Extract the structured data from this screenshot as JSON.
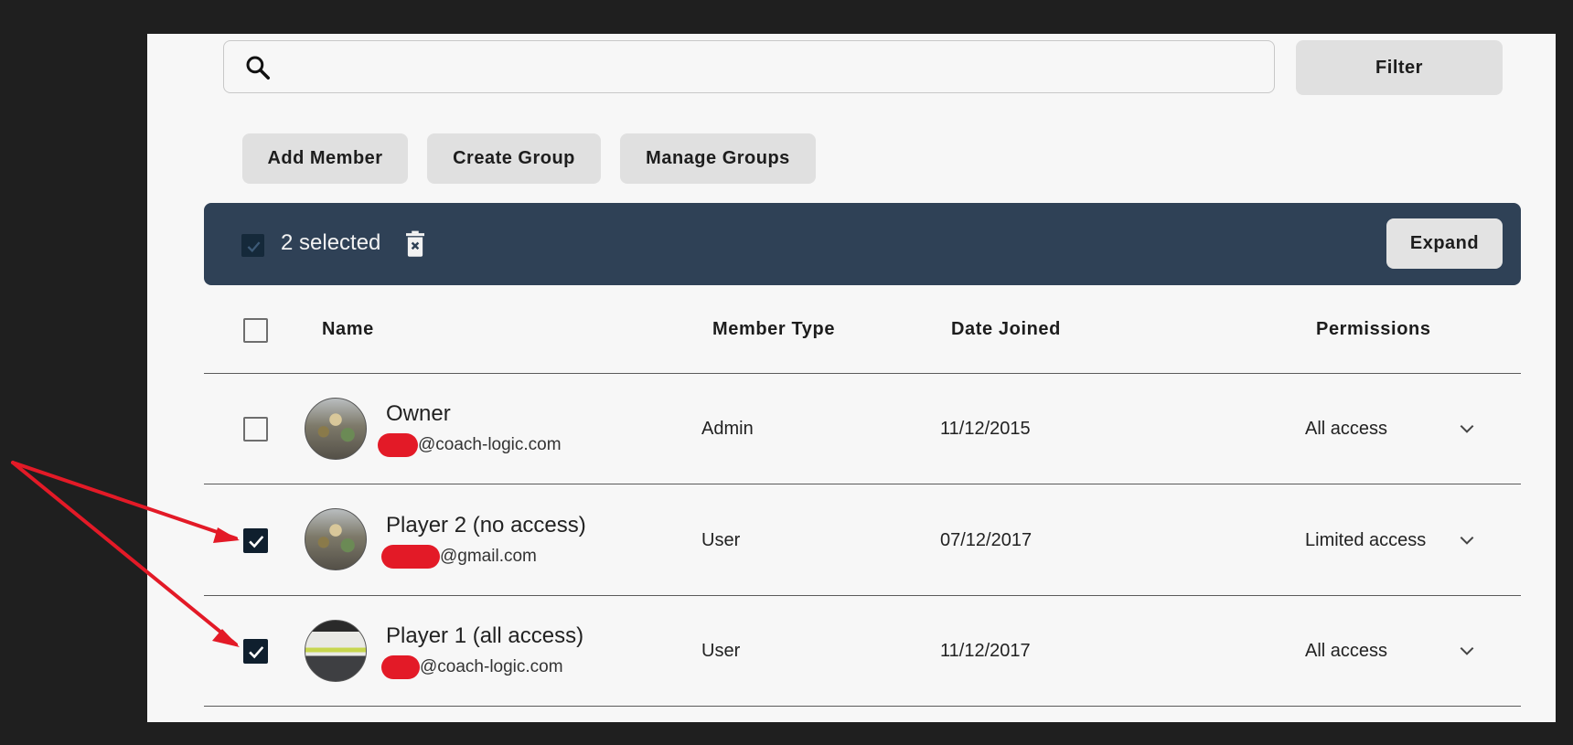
{
  "search": {
    "placeholder": "",
    "value": ""
  },
  "toolbar": {
    "filter_label": "Filter",
    "add_member_label": "Add Member",
    "create_group_label": "Create Group",
    "manage_groups_label": "Manage Groups"
  },
  "selection_bar": {
    "selected_text": "2 selected",
    "expand_label": "Expand",
    "checked": true
  },
  "table": {
    "headers": {
      "name": "Name",
      "member_type": "Member Type",
      "date_joined": "Date Joined",
      "permissions": "Permissions"
    },
    "rows": [
      {
        "checked": false,
        "name": "Owner",
        "email_domain": "@coach-logic.com",
        "member_type": "Admin",
        "date_joined": "11/12/2015",
        "permissions": "All access",
        "avatar": "photo-a"
      },
      {
        "checked": true,
        "name": "Player 2 (no access)",
        "email_domain": "@gmail.com",
        "member_type": "User",
        "date_joined": "07/12/2017",
        "permissions": "Limited access",
        "avatar": "photo-a"
      },
      {
        "checked": true,
        "name": "Player 1 (all access)",
        "email_domain": "@coach-logic.com",
        "member_type": "User",
        "date_joined": "11/12/2017",
        "permissions": "All access",
        "avatar": "photo-b"
      }
    ]
  },
  "icons": {
    "search": "search-icon",
    "delete": "trash-icon",
    "expand_row": "chevron-down-icon",
    "check": "check-icon"
  },
  "colors": {
    "selection_bar_bg": "#2f4156",
    "checkbox_checked": "#0f1f2e",
    "button_bg": "#e0e0e0",
    "annotation_arrow": "#e31a27",
    "redaction": "#e31a27"
  }
}
